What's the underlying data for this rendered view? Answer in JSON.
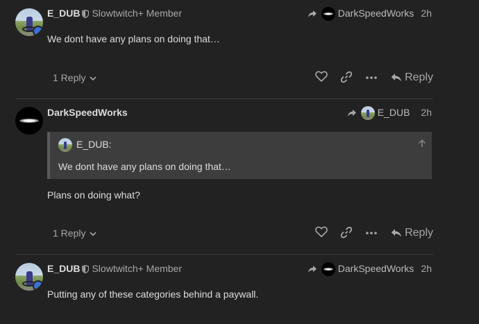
{
  "posts": [
    {
      "author": "E_DUB",
      "user_title": "Slowtwitch+ Member",
      "reply_to": "DarkSpeedWorks",
      "time": "2h",
      "body": "We dont have any plans on doing that…",
      "replies_label": "1 Reply",
      "reply_label": "Reply"
    },
    {
      "author": "DarkSpeedWorks",
      "reply_to": "E_DUB",
      "time": "2h",
      "quote_author": "E_DUB:",
      "quote_text": "We dont have any plans on doing that…",
      "body": "Plans on doing what?",
      "replies_label": "1 Reply",
      "reply_label": "Reply"
    },
    {
      "author": "E_DUB",
      "user_title": "Slowtwitch+ Member",
      "reply_to": "DarkSpeedWorks",
      "time": "2h",
      "body": "Putting any of these categories behind a paywall."
    }
  ],
  "icons": {
    "shield": "shield-icon",
    "reply_arrow": "share-arrow-icon",
    "like": "heart-icon",
    "link": "link-icon",
    "more": "ellipsis-icon",
    "chevron": "chevron-down-icon",
    "quote_up": "arrow-up-icon"
  },
  "colors": {
    "background": "#222222",
    "text": "#dddddd",
    "muted": "#a8a8a8",
    "quote_bg": "#3d3d3d"
  }
}
